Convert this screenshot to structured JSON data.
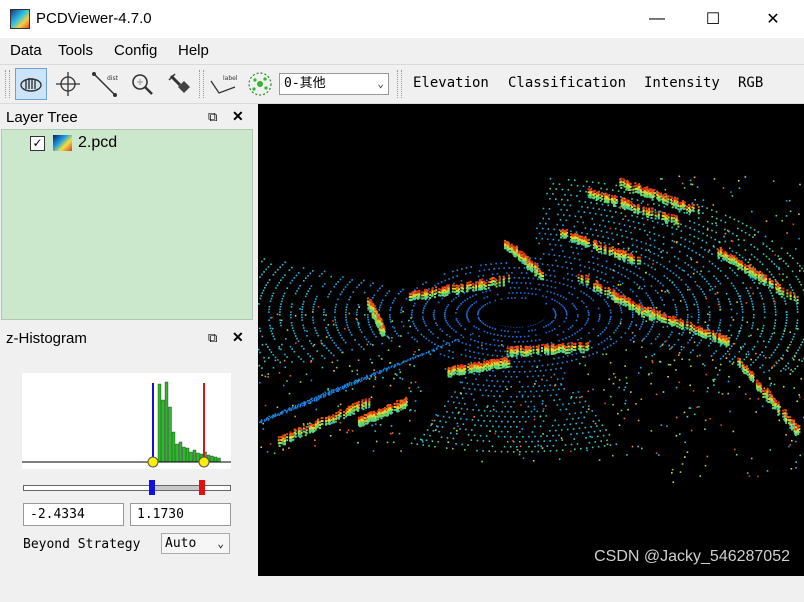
{
  "window": {
    "title": "PCDViewer-4.7.0",
    "buttons": {
      "minimize": "—",
      "maximize": "☐",
      "close": "✕"
    }
  },
  "menubar": {
    "items": [
      "Data",
      "Tools",
      "Config",
      "Help"
    ]
  },
  "toolbar": {
    "tools": [
      "rotate-icon",
      "pick-point-icon",
      "measure-distance-icon",
      "zoom-icon",
      "brush-icon",
      "label-icon",
      "classify-icon"
    ],
    "class_combo": "0-其他",
    "modes": [
      "Elevation",
      "Classification",
      "Intensity",
      "RGB"
    ]
  },
  "layer_tree": {
    "title": "Layer Tree",
    "layers": [
      {
        "name": "2.pcd",
        "checked": true
      }
    ]
  },
  "histogram": {
    "title": "z-Histogram",
    "min_value": "-2.4334",
    "max_value": "1.1730",
    "beyond_label": "Beyond Strategy",
    "beyond_value": "Auto"
  },
  "watermark": "CSDN @Jacky_546287052",
  "colors": {
    "layer_bg": "#cce8cc",
    "hist_bar": "#2db82d",
    "min_marker": "#1010e0",
    "max_marker": "#e01010",
    "viewport_bg": "#000000"
  }
}
